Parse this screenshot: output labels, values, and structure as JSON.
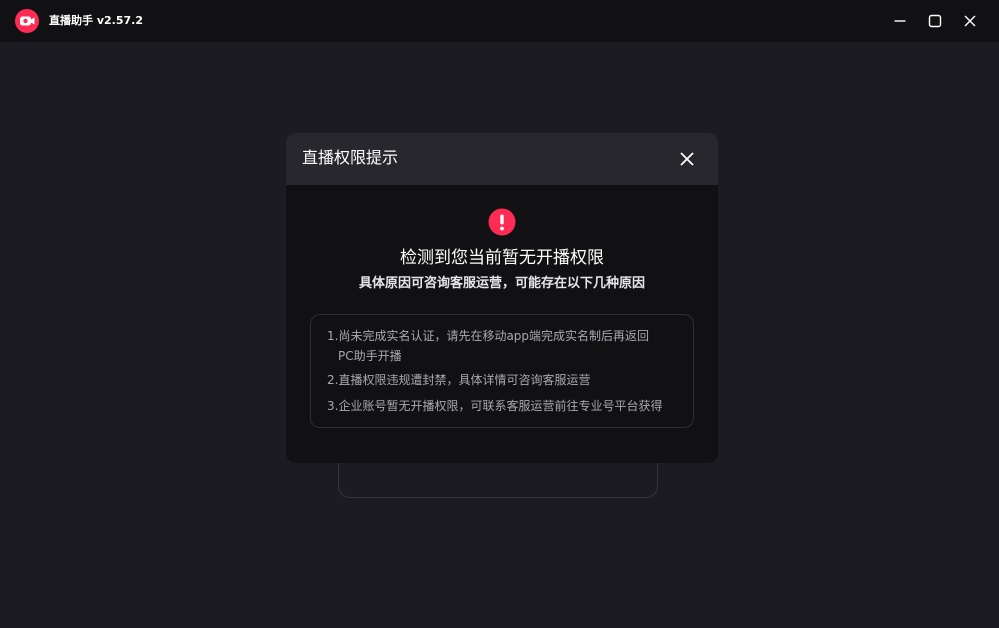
{
  "app": {
    "title": "直播助手 v2.57.2",
    "brand_color": "#fe2c55",
    "logo_icon": "camera-icon"
  },
  "window_controls": {
    "minimize_icon": "minimize-icon",
    "maximize_icon": "maximize-icon",
    "close_icon": "close-icon"
  },
  "dialog": {
    "title": "直播权限提示",
    "warning_icon": "exclamation-icon",
    "warning_color": "#fe2c55",
    "heading": "检测到您当前暂无开播权限",
    "subheading": "具体原因可咨询客服运营，可能存在以下几种原因",
    "reasons": [
      {
        "line1": "1.尚未完成实名认证，请先在移动app端完成实名制后再返回",
        "line2": "PC助手开播"
      },
      {
        "line1": "2.直播权限违规遭封禁，具体详情可咨询客服运营"
      },
      {
        "line1": "3.企业账号暂无开播权限，可联系客服运营前往专业号平台获得"
      }
    ]
  }
}
